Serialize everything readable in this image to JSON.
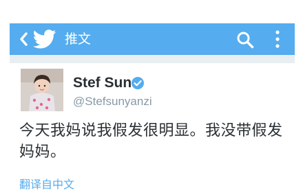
{
  "header": {
    "title": "推文",
    "back_icon": "chevron-left-icon",
    "logo_icon": "twitter-bird-icon",
    "search_icon": "search-icon",
    "more_icon": "more-vertical-icon",
    "background": "#55acee"
  },
  "tweet": {
    "author_name": "Stef Sun",
    "verified_icon": "verified-badge-icon",
    "handle": "@Stefsunyanzi",
    "text": "今天我妈说我假发很明显。我没带假发妈妈。",
    "translate_link": "翻译自中文"
  },
  "colors": {
    "accent": "#55acee",
    "text": "#292f33",
    "muted": "#8899a6"
  }
}
